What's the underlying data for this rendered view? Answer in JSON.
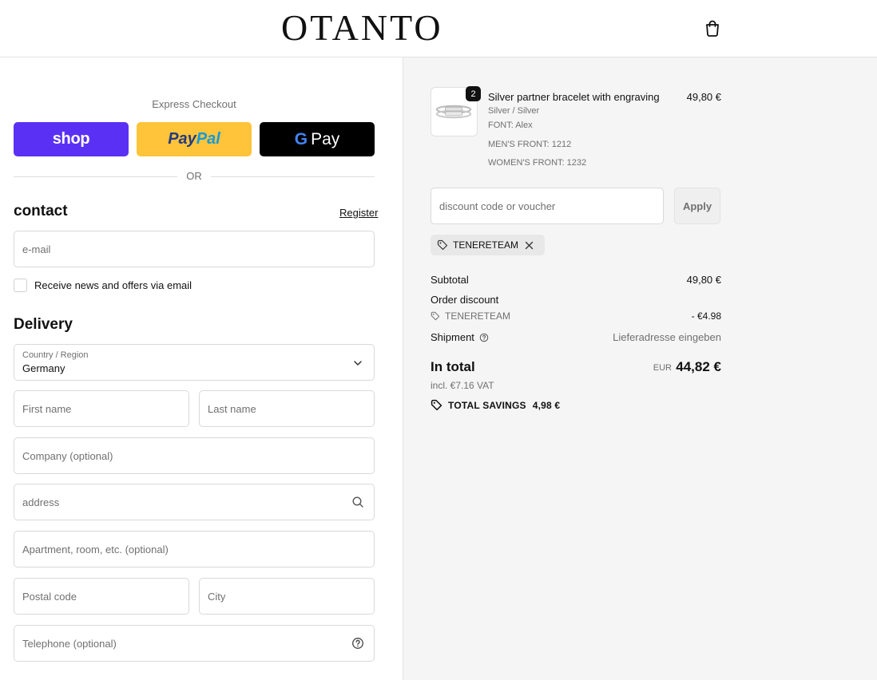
{
  "header": {
    "logo": "OTANTO",
    "bag_icon": "shopping-bag-icon"
  },
  "express": {
    "label": "Express Checkout",
    "shop_label": "shop",
    "paypal_part1": "Pay",
    "paypal_part2": "Pal",
    "gpay_g": "G",
    "gpay_label": "Pay",
    "or_label": "OR"
  },
  "contact": {
    "title": "contact",
    "register_label": "Register",
    "email_placeholder": "e-mail",
    "newsletter_label": "Receive news and offers via email"
  },
  "delivery": {
    "title": "Delivery",
    "country_label": "Country / Region",
    "country_value": "Germany",
    "first_name": "First name",
    "last_name": "Last name",
    "company": "Company (optional)",
    "address": "address",
    "apartment": "Apartment, room, etc. (optional)",
    "postal_code": "Postal code",
    "city": "City",
    "telephone": "Telephone (optional)"
  },
  "cart": {
    "item": {
      "quantity": "2",
      "title": "Silver partner bracelet with engraving",
      "variant": "Silver / Silver",
      "font": "FONT: Alex",
      "mens_front": "MEN'S FRONT: 1212",
      "womens_front": "WOMEN'S FRONT: 1232",
      "price": "49,80 €"
    },
    "discount_placeholder": "discount code or voucher",
    "apply_label": "Apply",
    "applied_code": "TENERETEAM"
  },
  "summary": {
    "subtotal_label": "Subtotal",
    "subtotal_value": "49,80 €",
    "order_discount_label": "Order discount",
    "discount_code": "TENERETEAM",
    "discount_value": "- €4.98",
    "shipment_label": "Shipment",
    "shipment_value": "Lieferadresse eingeben",
    "total_label": "In total",
    "currency": "EUR",
    "total_value": "44,82 €",
    "vat_text": "incl. €7.16 VAT",
    "savings_label": "TOTAL SAVINGS",
    "savings_value": "4,98 €"
  },
  "colors": {
    "shop_purple": "#5a31f4",
    "paypal_yellow": "#ffc439",
    "gpay_black": "#000000",
    "summary_bg": "#f5f5f5"
  }
}
